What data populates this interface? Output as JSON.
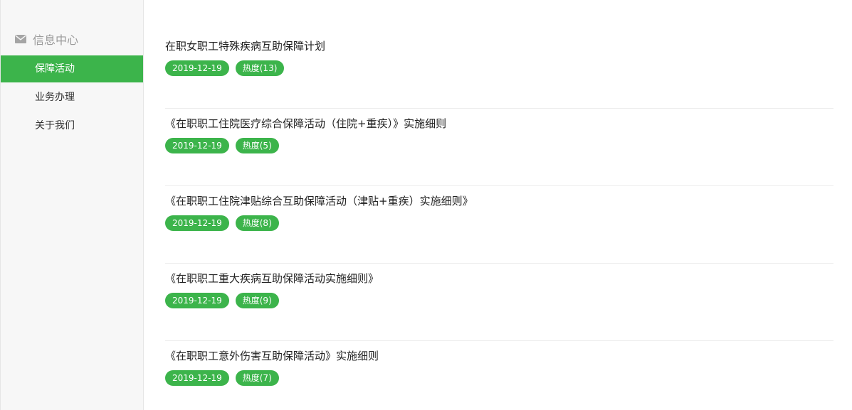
{
  "sidebar": {
    "header": {
      "icon": "envelope-icon",
      "label": "信息中心"
    },
    "items": [
      {
        "label": "保障活动",
        "active": true
      },
      {
        "label": "业务办理",
        "active": false
      },
      {
        "label": "关于我们",
        "active": false
      }
    ]
  },
  "articles": [
    {
      "title": "在职女职工特殊疾病互助保障计划",
      "date": "2019-12-19",
      "heat": "热度(13)"
    },
    {
      "title": "《在职职工住院医疗综合保障活动（住院+重疾）》实施细则",
      "date": "2019-12-19",
      "heat": "热度(5)"
    },
    {
      "title": "《在职职工住院津贴综合互助保障活动（津贴+重疾）实施细则》",
      "date": "2019-12-19",
      "heat": "热度(8)"
    },
    {
      "title": "《在职职工重大疾病互助保障活动实施细则》",
      "date": "2019-12-19",
      "heat": "热度(9)"
    },
    {
      "title": "《在职职工意外伤害互助保障活动》实施细则",
      "date": "2019-12-19",
      "heat": "热度(7)"
    }
  ],
  "colors": {
    "accent": "#3cb44b",
    "sidebar_bg": "#f7f7f7"
  }
}
